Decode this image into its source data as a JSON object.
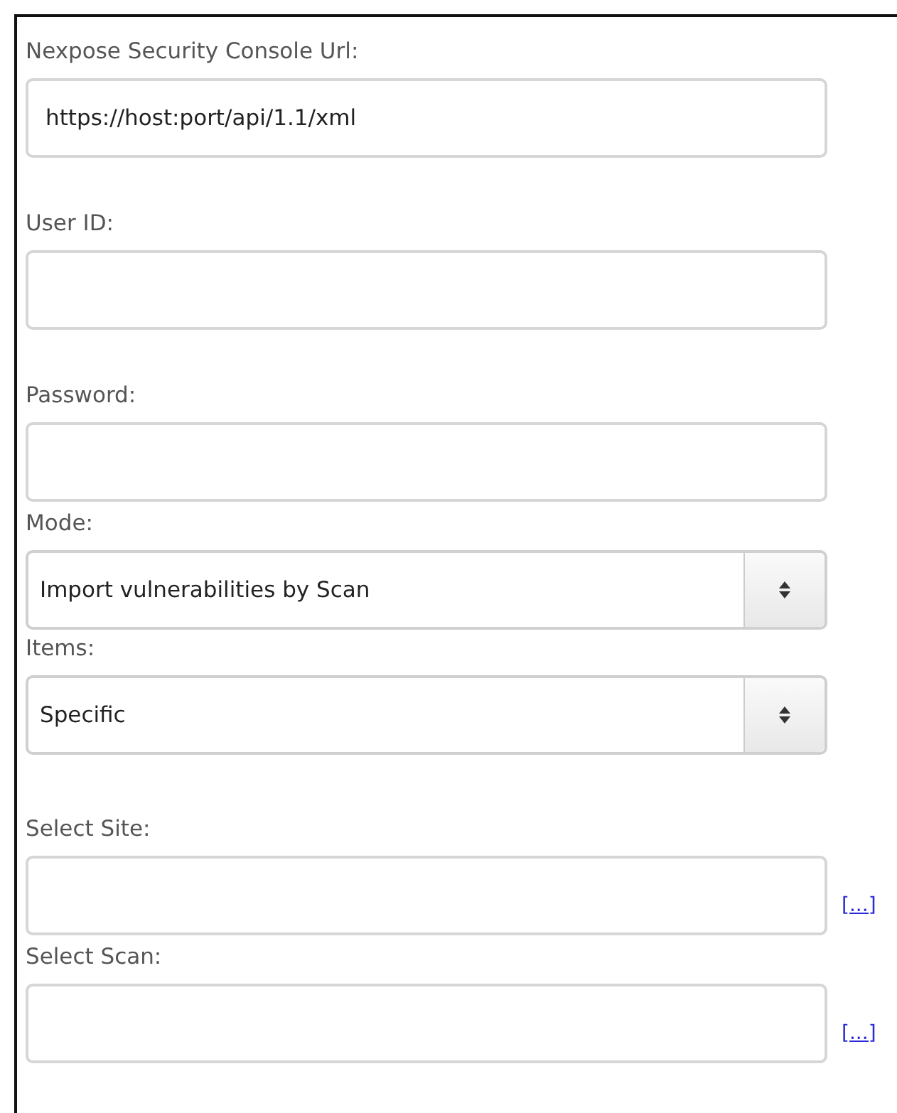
{
  "fields": [
    {
      "kind": "text",
      "label": "Nexpose Security Console Url:",
      "value": "https://host:port/api/1.1/xml"
    },
    {
      "kind": "text",
      "label": "User ID:"
    },
    {
      "kind": "password",
      "label": "Password:"
    },
    {
      "kind": "select",
      "label": "Mode:",
      "value": "Import vulnerabilities by Scan"
    },
    {
      "kind": "select",
      "label": "Items:",
      "value": "Specific"
    },
    {
      "kind": "picker",
      "label": "Select Site:",
      "link": "[...]"
    },
    {
      "kind": "picker",
      "label": "Select Scan:",
      "link": "[...]"
    }
  ]
}
